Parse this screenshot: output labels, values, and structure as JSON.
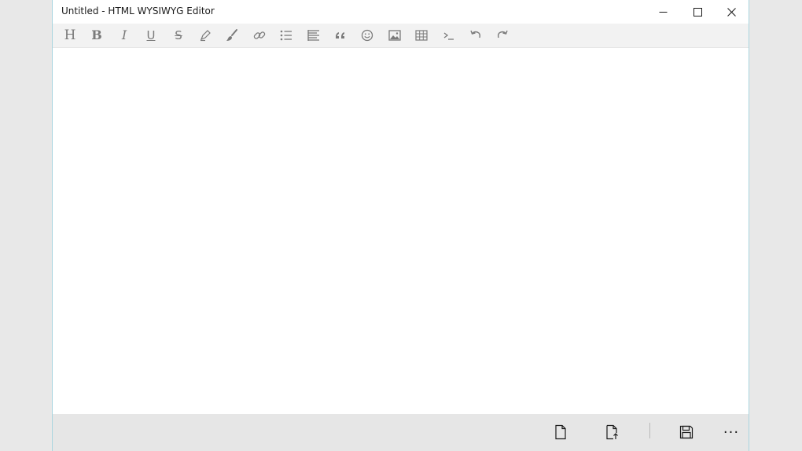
{
  "window": {
    "title": "Untitled - HTML WYSIWYG Editor"
  },
  "title_controls": [
    {
      "name": "minimize-button",
      "icon": "minimize-icon"
    },
    {
      "name": "maximize-button",
      "icon": "maximize-icon"
    },
    {
      "name": "close-button",
      "icon": "close-icon"
    }
  ],
  "toolbar": {
    "icons": [
      "heading-icon",
      "bold-icon",
      "italic-icon",
      "underline-icon",
      "strikethrough-icon",
      "highlight-pen-icon",
      "brush-icon",
      "link-icon",
      "bulleted-list-icon",
      "align-icon",
      "quote-icon",
      "emoji-icon",
      "image-icon",
      "table-icon",
      "code-icon",
      "undo-icon",
      "redo-icon"
    ],
    "glyphs": {
      "heading": "H",
      "bold": "B",
      "italic": "I",
      "underline": "U",
      "strikethrough": "S"
    }
  },
  "command_bar": {
    "icons": [
      "new-file-icon",
      "open-file-icon",
      "save-icon",
      "more-icon"
    ],
    "more_glyph": "···"
  },
  "colors": {
    "window_bg": "#ffffff",
    "toolbar_bg": "#f2f2f2",
    "commandbar_bg": "#e6e6e6",
    "icon_color": "#7a7a7a",
    "desktop_bg": "#e8e8e8",
    "accent_border": "#a9d5df"
  }
}
